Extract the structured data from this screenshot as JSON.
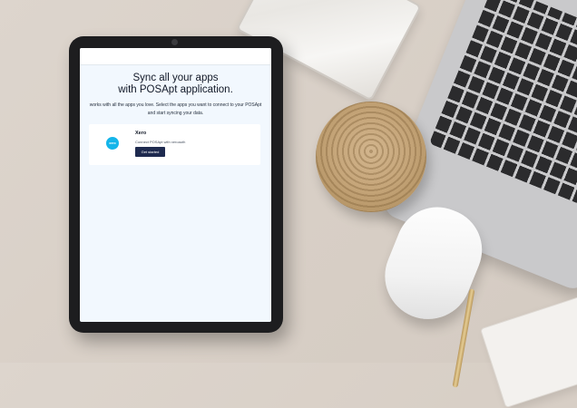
{
  "screen": {
    "heading_line1": "Sync all your apps",
    "heading_line2": "with POSApt application.",
    "subtitle_line1": "works with all the apps you love. Select the apps you want to connect to your POSApt",
    "subtitle_line2": "and start syncing your data."
  },
  "integration": {
    "logo_text": "xero",
    "name": "Xero",
    "description": "Connect POSApt with xeroauth",
    "button_label": "Get started"
  },
  "colors": {
    "screen_background": "#f2f8fe",
    "button": "#1e2a4f",
    "xero_brand": "#14b5ea"
  }
}
